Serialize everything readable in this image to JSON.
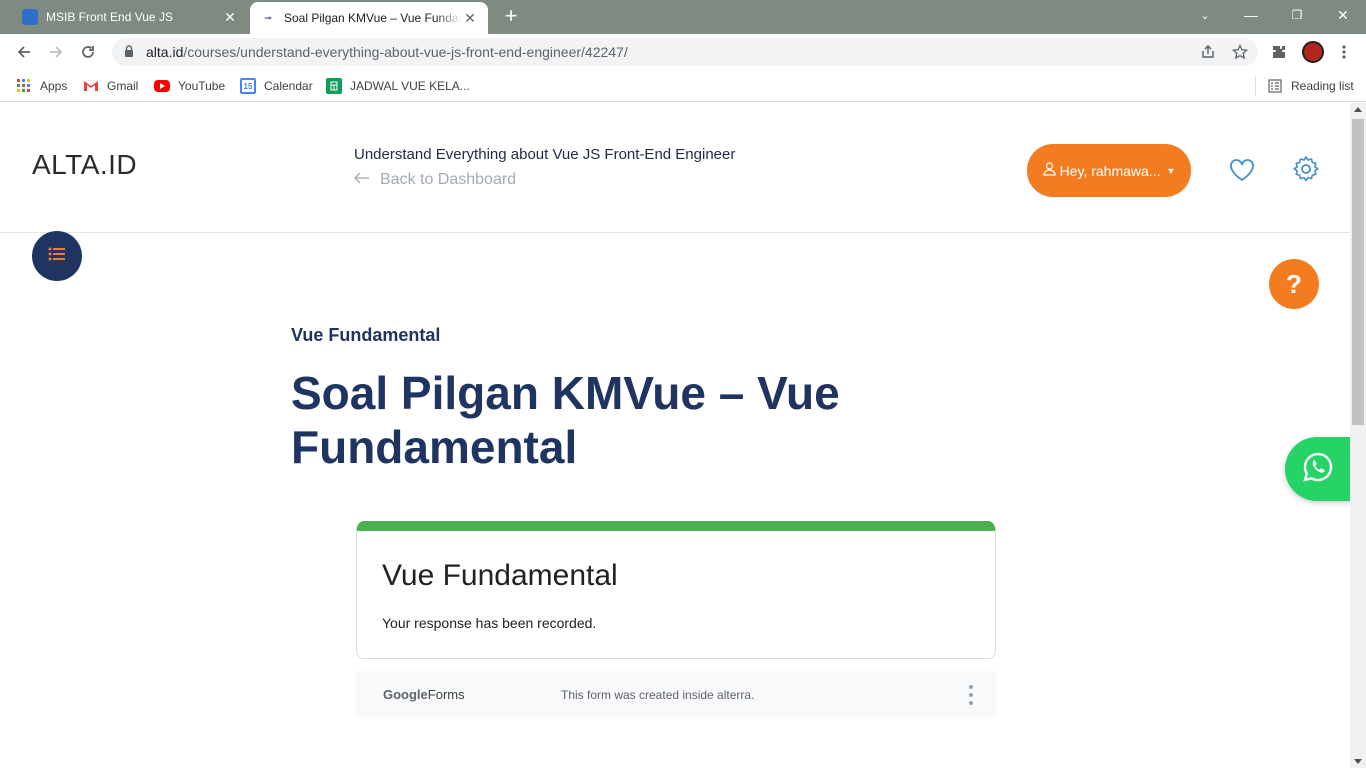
{
  "browser": {
    "tabs": [
      {
        "title": "MSIB Front End Vue JS",
        "active": false
      },
      {
        "title": "Soal Pilgan KMVue – Vue Fundamental",
        "active": true
      }
    ],
    "url_host": "alta.id",
    "url_path": "/courses/understand-everything-about-vue-js-front-end-engineer/42247/",
    "bookmarks": [
      {
        "label": "Apps",
        "icon": "apps-grid-icon"
      },
      {
        "label": "Gmail",
        "icon": "gmail-icon"
      },
      {
        "label": "YouTube",
        "icon": "youtube-icon"
      },
      {
        "label": "Calendar",
        "icon": "calendar-icon"
      },
      {
        "label": "JADWAL VUE KELA...",
        "icon": "sheets-icon"
      }
    ],
    "reading_list": "Reading list",
    "calendar_day": "15"
  },
  "header": {
    "logo": "ALTA.ID",
    "course_title": "Understand Everything about Vue JS Front-End Engineer",
    "back_link": "Back to Dashboard",
    "user_button": "Hey, rahmawa..."
  },
  "lesson": {
    "section": "Vue Fundamental",
    "title": "Soal Pilgan KMVue – Vue Fundamental"
  },
  "form": {
    "title": "Vue Fundamental",
    "message": "Your response has been recorded.",
    "brand_google": "Google",
    "brand_forms": "Forms",
    "footer_note": "This form was created inside alterra."
  },
  "fab": {
    "help": "?"
  },
  "colors": {
    "accent_orange": "#f47c20",
    "navy": "#1f3460",
    "form_band": "#4caf50",
    "whatsapp": "#25d366"
  }
}
